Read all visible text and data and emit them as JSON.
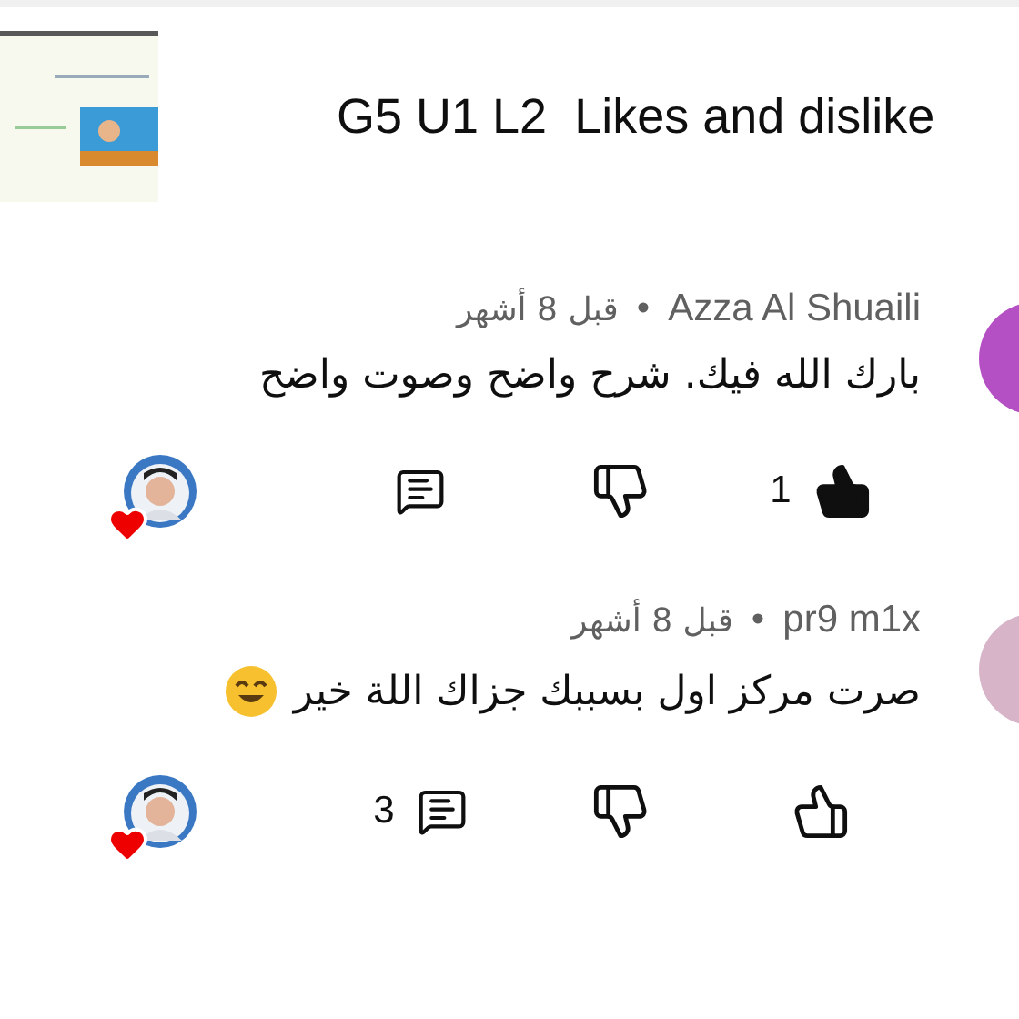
{
  "video": {
    "title": "G5 U1 L2  Likes and dislike"
  },
  "comments": [
    {
      "kind": "text",
      "author": "Azza Al Shuaili",
      "separator": "•",
      "age": "قبل 8 أشهر",
      "color": "#b44fc4",
      "text": "بارك الله فيك. شرح واضح وصوت واضح",
      "liked": true,
      "like_count": "1",
      "hearted": true
    },
    {
      "kind": "text_with_emoji",
      "author": "pr9 m1x",
      "separator": "•",
      "age": "قبل 8 أشهر",
      "color": "#d8b4c8",
      "text": "صرت مركز اول بسببك جزاك اللة خير",
      "liked": false,
      "reply_count": "3",
      "hearted": true
    }
  ]
}
